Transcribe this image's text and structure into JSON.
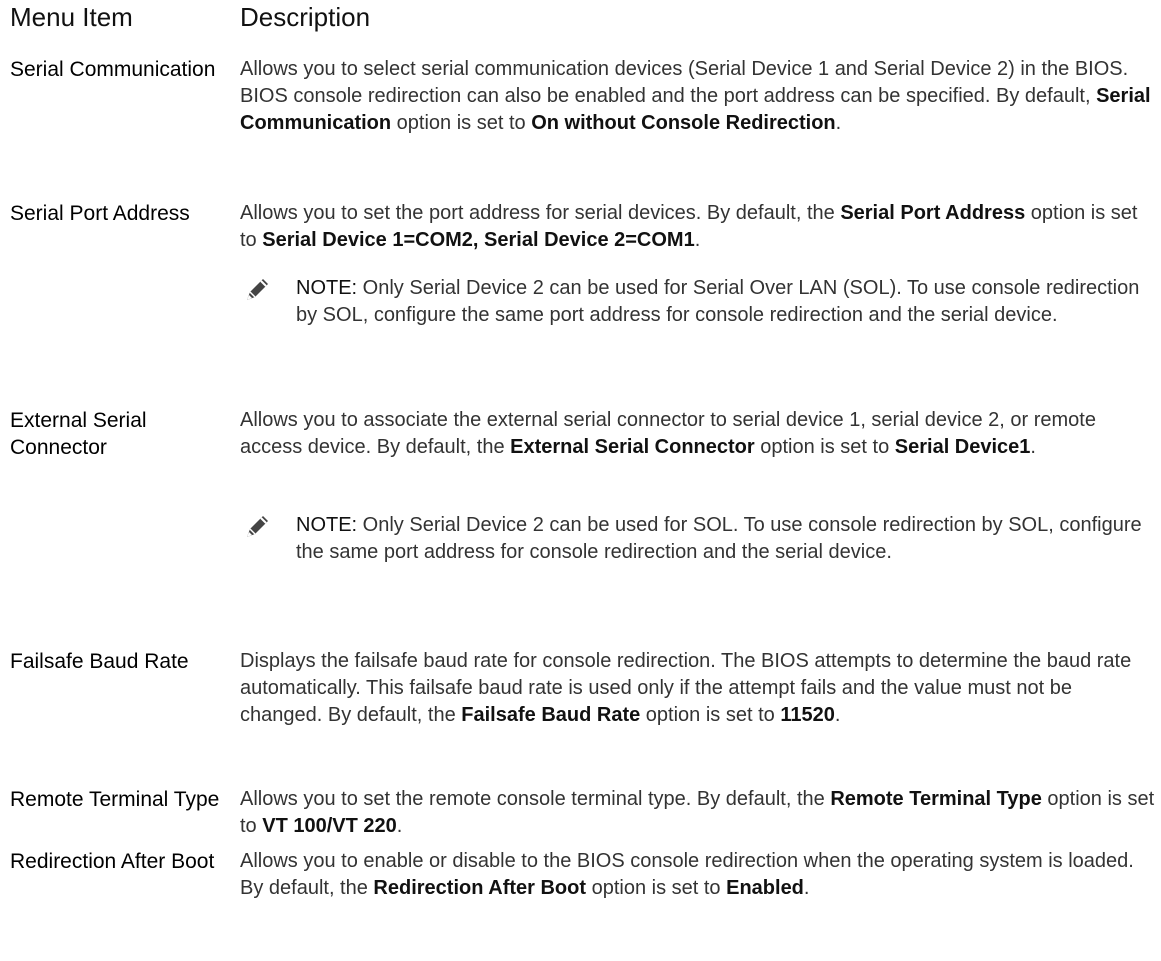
{
  "headers": {
    "menu_item": "Menu Item",
    "description": "Description"
  },
  "rows": [
    {
      "term": "Serial Communication",
      "desc": [
        {
          "t": "Allows you to select serial communication devices (Serial Device 1 and Serial Device 2) in the BIOS. BIOS console redirection can also be enabled and the port address can be specified. By default, "
        },
        {
          "t": "Serial Communication",
          "b": true
        },
        {
          "t": " option is set to "
        },
        {
          "t": "On without Console Redirection",
          "b": true
        },
        {
          "t": "."
        }
      ]
    },
    {
      "term": "Serial Port Address",
      "desc": [
        {
          "t": "Allows you to set the port address for serial devices. By default, the "
        },
        {
          "t": "Serial Port Address",
          "b": true
        },
        {
          "t": " option is set to "
        },
        {
          "t": "Serial Device 1=COM2, Serial Device 2=COM1",
          "b": true
        },
        {
          "t": "."
        }
      ],
      "note": {
        "label": "NOTE:",
        "text": " Only Serial Device 2 can be used for Serial Over LAN (SOL). To use console redirection by SOL, configure the same port address for console redirection and the serial device.",
        "icon": "pencil-note-icon"
      }
    },
    {
      "term": "External Serial Connector",
      "desc": [
        {
          "t": "Allows you to associate the external serial connector to serial device 1, serial device 2, or remote access device. By default, the "
        },
        {
          "t": "External Serial Connector",
          "b": true
        },
        {
          "t": " option is set to "
        },
        {
          "t": "Serial Device1",
          "b": true
        },
        {
          "t": "."
        }
      ],
      "note": {
        "label": "NOTE:",
        "text": " Only Serial Device 2 can be used for SOL. To use console redirection by SOL, configure the same port address for console redirection and the serial device.",
        "icon": "pencil-note-icon"
      }
    },
    {
      "term": "Failsafe Baud Rate",
      "desc": [
        {
          "t": "Displays the failsafe baud rate for console redirection. The BIOS attempts to determine the baud rate automatically. This failsafe baud rate is used only if the attempt fails and the value must not be changed. By default, the "
        },
        {
          "t": "Failsafe Baud Rate",
          "b": true
        },
        {
          "t": " option is set to "
        },
        {
          "t": "11520",
          "b": true
        },
        {
          "t": "."
        }
      ]
    },
    {
      "term": "Remote Terminal Type",
      "desc": [
        {
          "t": "Allows you to set the remote console terminal type. By default, the "
        },
        {
          "t": "Remote Terminal Type",
          "b": true
        },
        {
          "t": " option is set to "
        },
        {
          "t": "VT 100/VT 220",
          "b": true
        },
        {
          "t": "."
        }
      ]
    },
    {
      "term": "Redirection After Boot",
      "desc": [
        {
          "t": "Allows you to enable or disable to the BIOS console redirection when the operating system is loaded. By default, the "
        },
        {
          "t": "Redirection After Boot",
          "b": true
        },
        {
          "t": " option is set to "
        },
        {
          "t": "Enabled",
          "b": true
        },
        {
          "t": "."
        }
      ]
    }
  ]
}
